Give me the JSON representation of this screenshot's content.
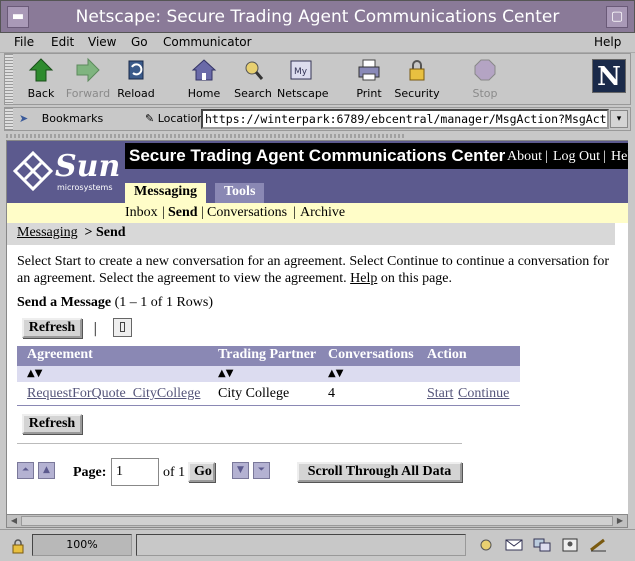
{
  "window": {
    "title": "Netscape: Secure Trading Agent Communications Center"
  },
  "menu": [
    "File",
    "Edit",
    "View",
    "Go",
    "Communicator",
    "Help"
  ],
  "toolbar": {
    "back": "Back",
    "forward": "Forward",
    "reload": "Reload",
    "home": "Home",
    "search": "Search",
    "netscape": "Netscape",
    "print": "Print",
    "security": "Security",
    "stop": "Stop"
  },
  "locationbar": {
    "bookmarks": "Bookmarks",
    "location_label": "Location:",
    "url": "https://winterpark:6789/ebcentral/manager/MsgAction?MsgAct"
  },
  "header": {
    "logo_text": "Sun",
    "logo_sub": "microsystems",
    "app_title": "Secure Trading Agent Communications Center",
    "links": [
      "About",
      "Log Out",
      "Help"
    ]
  },
  "tabs": [
    "Messaging",
    "Tools"
  ],
  "subnav": {
    "items": [
      "Inbox",
      "Send",
      "Conversations",
      "Archive"
    ],
    "separator": "|"
  },
  "breadcrumb": {
    "parent": "Messaging",
    "sep": " > ",
    "current": "Send"
  },
  "intro": {
    "text": "Select Start to create a new conversation for an agreement. Select Continue to continue a conversation for an agreement. Select the agreement to view the agreement.",
    "help_link": "Help",
    "tail": " on this page."
  },
  "section": {
    "title": "Send a Message",
    "rows_info": "(1 – 1 of 1 Rows)"
  },
  "buttons": {
    "refresh": "Refresh",
    "go": "Go",
    "scroll_all": "Scroll Through All Data"
  },
  "table": {
    "columns": [
      "Agreement",
      "Trading Partner",
      "Conversations",
      "Action"
    ],
    "sort_symbol": "▲▼",
    "rows": [
      {
        "agreement": "RequestForQuote_CityCollege",
        "partner": "City College",
        "conversations": "4",
        "start": "Start",
        "continue": "Continue"
      }
    ]
  },
  "pagination": {
    "label": "Page:",
    "current": "1",
    "of_label": "of 1"
  },
  "status": {
    "zoom": "100%"
  }
}
